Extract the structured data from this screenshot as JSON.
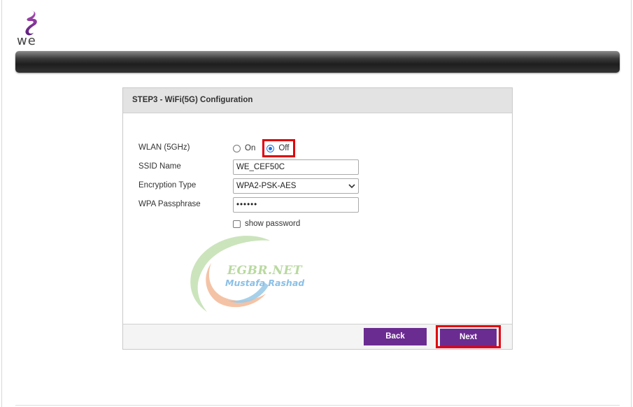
{
  "brand": {
    "logo_text": "we"
  },
  "wizard": {
    "title": "STEP3 - WiFi(5G) Configuration",
    "wlan": {
      "label": "WLAN (5GHz)",
      "on_label": "On",
      "off_label": "Off",
      "selected": "Off"
    },
    "ssid": {
      "label": "SSID Name",
      "value": "WE_CEF50C"
    },
    "encryption": {
      "label": "Encryption Type",
      "value": "WPA2-PSK-AES"
    },
    "passphrase": {
      "label": "WPA Passphrase",
      "value": "••••••"
    },
    "show_password": {
      "label": "show password",
      "checked": false
    },
    "buttons": {
      "back": "Back",
      "next": "Next"
    }
  },
  "watermark": {
    "title": "EGBR.NET",
    "subtitle": "Mustafa Rashad"
  },
  "colors": {
    "button": "#6b2c91",
    "highlight": "#e0000f",
    "header_bg": "#e3e3e3"
  }
}
